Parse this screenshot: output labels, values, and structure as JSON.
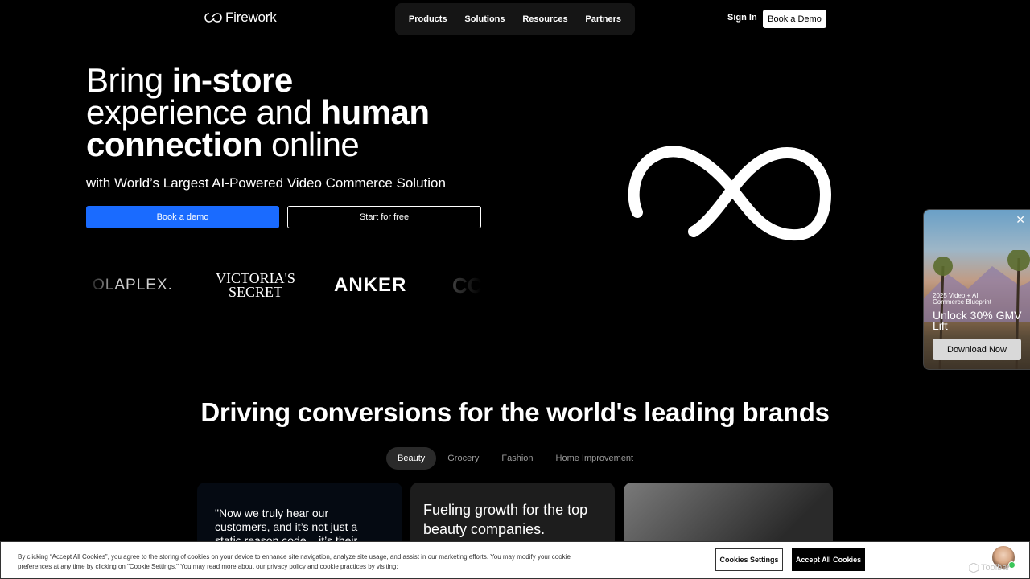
{
  "brand": {
    "name": "Firework"
  },
  "nav": {
    "items": [
      "Products",
      "Solutions",
      "Resources",
      "Partners"
    ]
  },
  "header": {
    "sign_in": "Sign In",
    "book_demo": "Book a Demo"
  },
  "hero": {
    "title_parts": [
      "Bring ",
      "in-store",
      " experience and ",
      "human",
      " ",
      "connection",
      " online"
    ],
    "subtitle": "with World’s Largest AI-Powered Video Commerce Solution",
    "primary_cta": "Book a demo",
    "secondary_cta": "Start for free"
  },
  "brand_logos": {
    "olaplex": "OLAPLEX.",
    "vs_line1": "VICTORIA'S",
    "vs_line2": "SECRET",
    "anker": "ANKER",
    "partial": "CC"
  },
  "promo": {
    "kicker": "2025 Video + AI Commerce Blueprint",
    "headline": "Unlock 30% GMV Lift",
    "cta": "Download Now",
    "close": "✕"
  },
  "section": {
    "title": "Driving conversions for the world's leading brands",
    "tabs": [
      "Beauty",
      "Grocery",
      "Fashion",
      "Home Improvement"
    ],
    "active_tab": "Beauty",
    "card1_quote": "\"Now we truly hear our customers, and it’s not just a static reason code – it’s their",
    "card2_text": "Fueling growth for the top beauty companies."
  },
  "cookie": {
    "text": "By clicking “Accept All Cookies”, you agree to the storing of cookies on your device to enhance site navigation, analyze site usage, and assist in our marketing efforts. You may modify your cookie preferences at any time by clicking on \"Cookie Settings.\" You may read more about our privacy policy and cookie practices by visiting:",
    "settings_label": "Cookies Settings",
    "accept_label": "Accept All Cookies"
  },
  "watermark": "Toolbar",
  "colors": {
    "accent": "#1a6bff",
    "background": "#000000",
    "nav_bg": "#151515"
  }
}
